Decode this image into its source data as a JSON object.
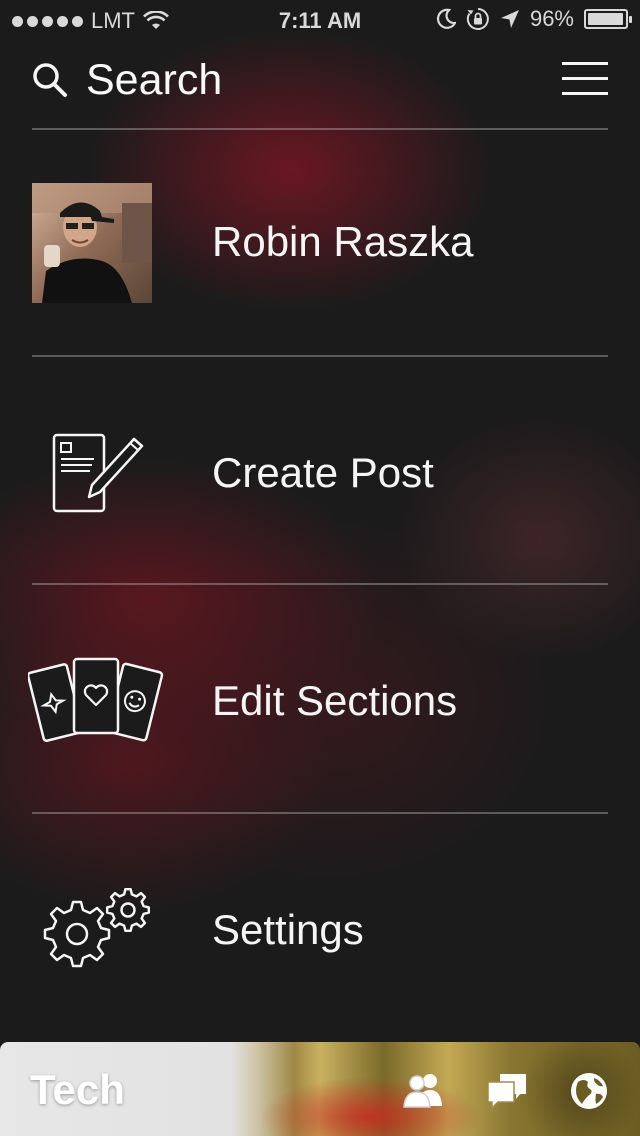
{
  "status_bar": {
    "carrier": "LMT",
    "time": "7:11 AM",
    "battery_percent": "96%",
    "battery_level": 0.96
  },
  "header": {
    "search_label": "Search"
  },
  "menu": {
    "items": [
      {
        "label": "Robin Raszka",
        "icon": "avatar-photo"
      },
      {
        "label": "Create Post",
        "icon": "create-post-icon"
      },
      {
        "label": "Edit Sections",
        "icon": "cards-icon"
      },
      {
        "label": "Settings",
        "icon": "gears-icon"
      }
    ]
  },
  "bottom_bar": {
    "section_title": "Tech",
    "icons": [
      "people-icon",
      "chat-bubbles-icon",
      "globe-icon"
    ]
  },
  "colors": {
    "background": "#1c1b1c",
    "accent_red": "#7a1622",
    "text": "#f5f5f5"
  }
}
